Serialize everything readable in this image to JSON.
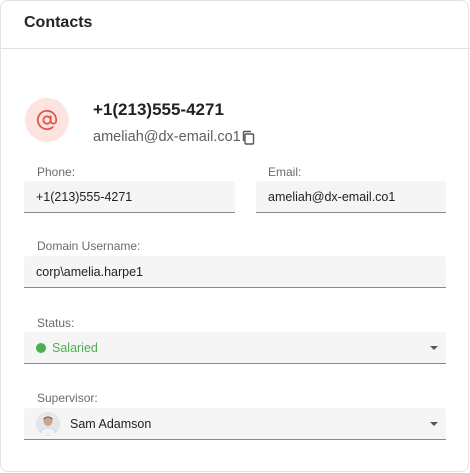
{
  "header": {
    "title": "Contacts"
  },
  "contact": {
    "phone_primary": "+1(213)555-4271",
    "email_primary": "ameliah@dx-email.co1"
  },
  "fields": {
    "phone": {
      "label": "Phone:",
      "value": "+1(213)555-4271"
    },
    "email": {
      "label": "Email:",
      "value": "ameliah@dx-email.co1"
    },
    "domain_username": {
      "label": "Domain Username:",
      "value": "corp\\amelia.harpe1"
    },
    "status": {
      "label": "Status:",
      "value": "Salaried",
      "color": "#4caf50"
    },
    "supervisor": {
      "label": "Supervisor:",
      "value": "Sam Adamson"
    }
  },
  "icons": {
    "contact_avatar": "at-sign-icon",
    "copy": "copy-icon",
    "dropdown": "chevron-down-icon"
  },
  "colors": {
    "accent_avatar_bg": "#fde4e1",
    "accent_at": "#e2574c"
  }
}
